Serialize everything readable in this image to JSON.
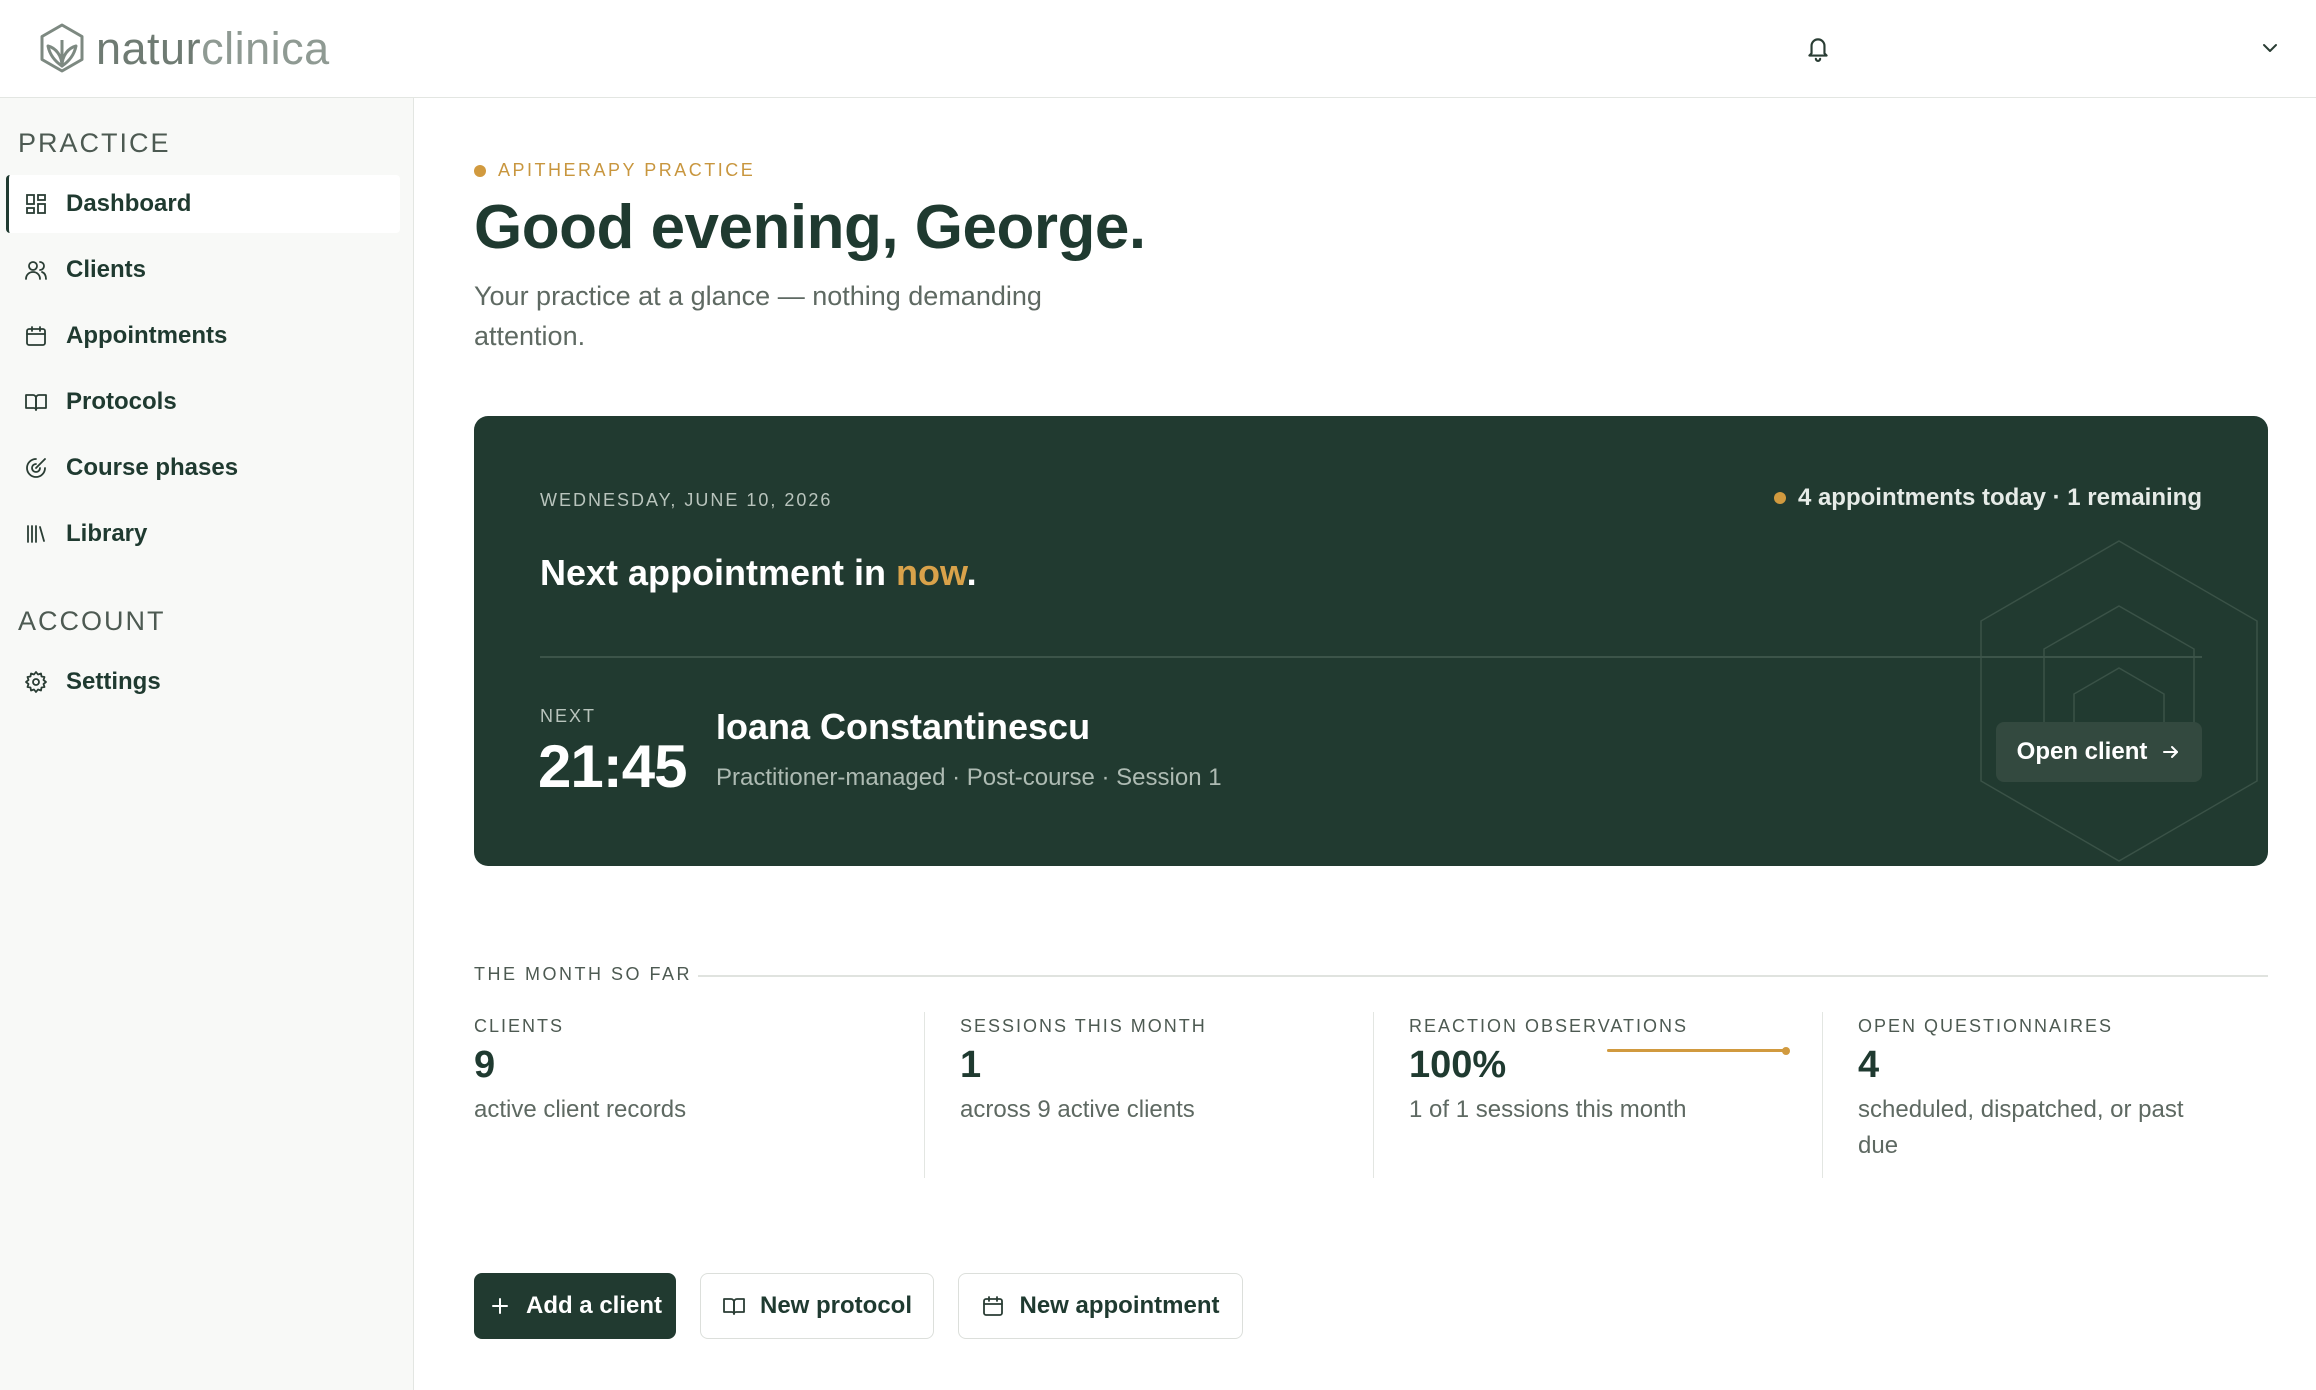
{
  "brand": {
    "name_part1": "natur",
    "name_part2": "clinica"
  },
  "header": {
    "notifications_icon": "bell-icon",
    "account_menu_icon": "chevron-down-icon"
  },
  "sidebar": {
    "practice_heading": "PRACTICE",
    "account_heading": "ACCOUNT",
    "items": [
      {
        "label": "Dashboard",
        "icon": "dashboard-icon",
        "active": true
      },
      {
        "label": "Clients",
        "icon": "users-icon",
        "active": false
      },
      {
        "label": "Appointments",
        "icon": "calendar-icon",
        "active": false
      },
      {
        "label": "Protocols",
        "icon": "book-icon",
        "active": false
      },
      {
        "label": "Course phases",
        "icon": "phases-icon",
        "active": false
      },
      {
        "label": "Library",
        "icon": "library-icon",
        "active": false
      }
    ],
    "account_items": [
      {
        "label": "Settings",
        "icon": "gear-icon"
      }
    ]
  },
  "main": {
    "eyebrow": "APITHERAPY PRACTICE",
    "greeting": "Good evening, George.",
    "subtitle": "Your practice at a glance — nothing demanding attention."
  },
  "hero": {
    "date": "WEDNESDAY, JUNE 10, 2026",
    "status": "4 appointments today · 1 remaining",
    "next_prefix": "Next appointment in ",
    "next_highlight": "now",
    "next_suffix": ".",
    "next_label": "NEXT",
    "time": "21:45",
    "client_name": "Ioana Constantinescu",
    "client_meta": "Practitioner-managed · Post-course · Session 1",
    "open_button": "Open client"
  },
  "month": {
    "label": "THE MONTH SO FAR",
    "stats": [
      {
        "label": "CLIENTS",
        "value": "9",
        "desc": "active client records"
      },
      {
        "label": "SESSIONS THIS MONTH",
        "value": "1",
        "desc": "across 9 active clients"
      },
      {
        "label": "REACTION OBSERVATIONS",
        "value": "100%",
        "desc": "1 of 1 sessions this month",
        "progress": 1.0
      },
      {
        "label": "OPEN QUESTIONNAIRES",
        "value": "4",
        "desc": "scheduled, dispatched, or past due"
      }
    ]
  },
  "actions": {
    "add_client": "Add a client",
    "new_protocol": "New protocol",
    "new_appointment": "New appointment"
  },
  "colors": {
    "primary": "#213a30",
    "accent": "#d19a3f"
  }
}
